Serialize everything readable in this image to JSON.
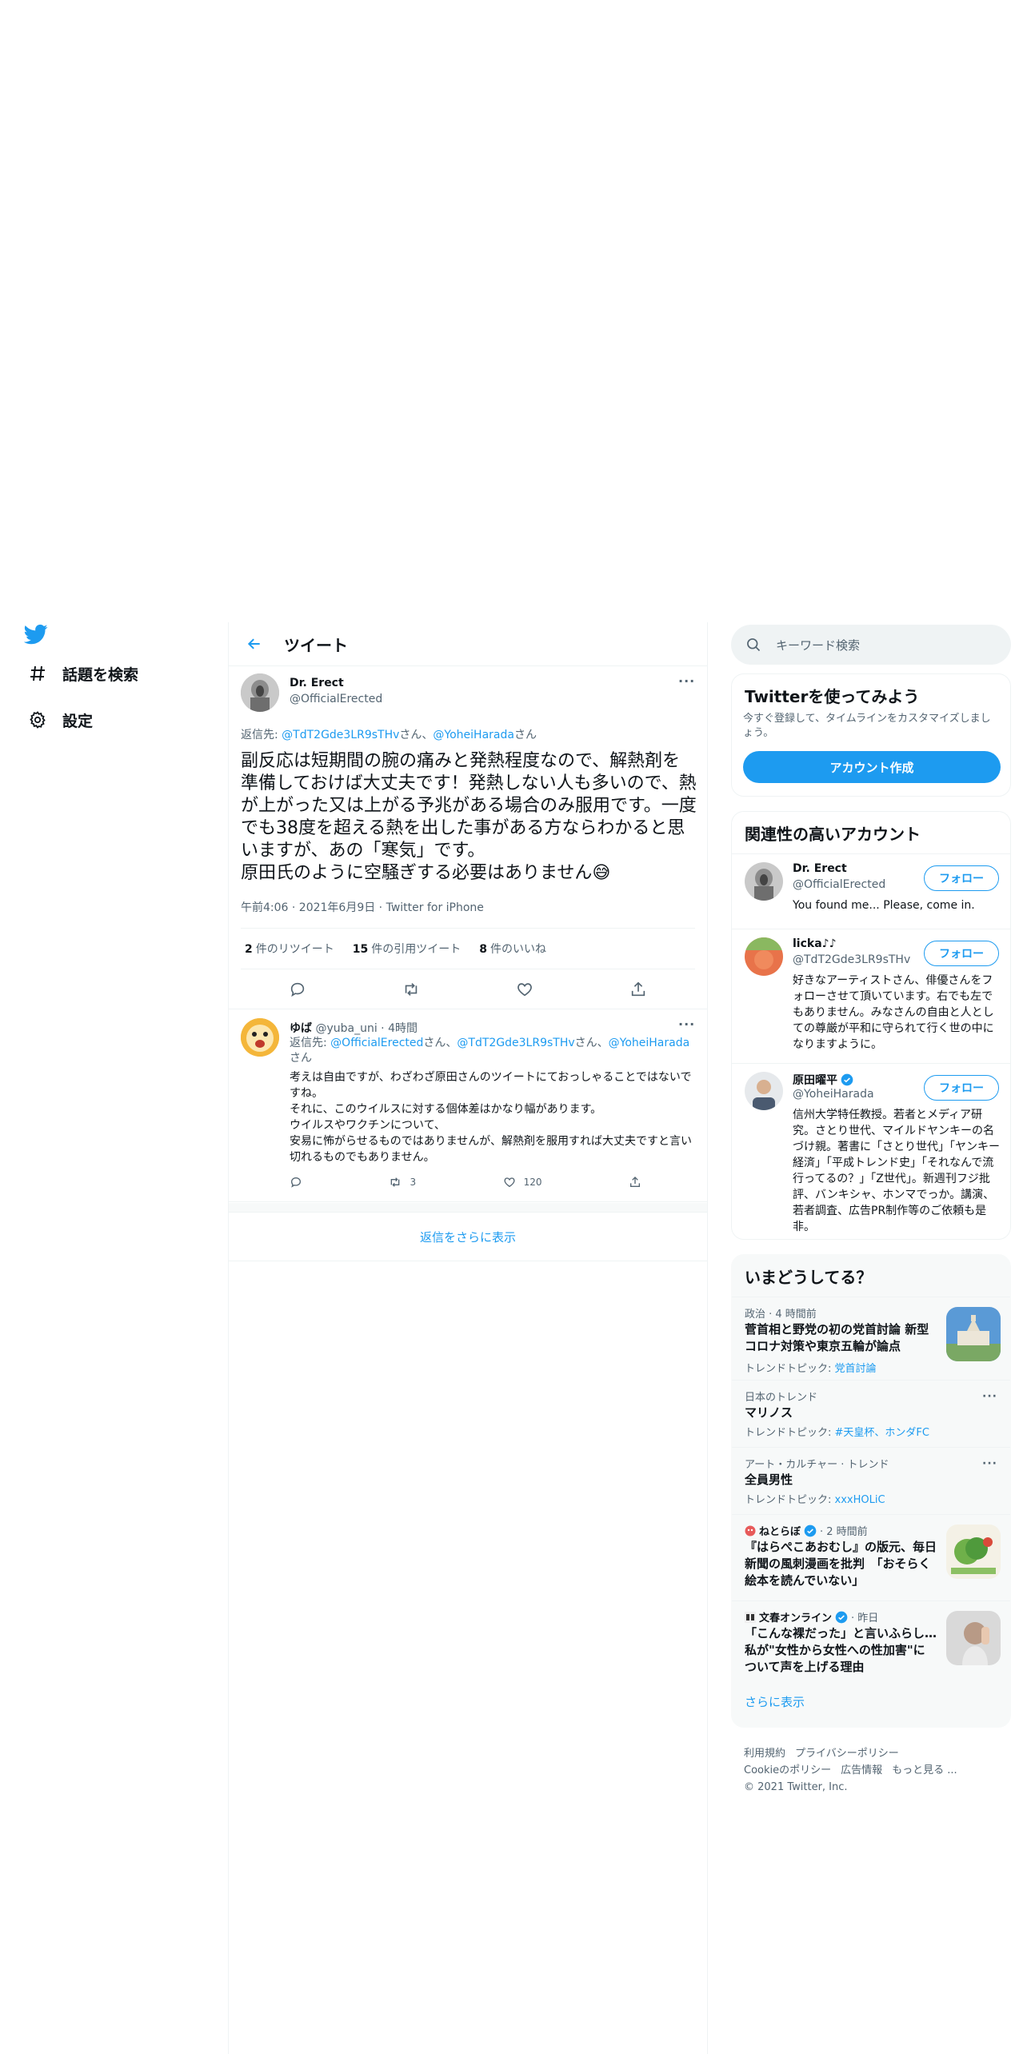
{
  "nav": {
    "explore_label": "話題を検索",
    "settings_label": "設定"
  },
  "header": {
    "title": "ツイート"
  },
  "tweet": {
    "name": "Dr. Erect",
    "handle": "@OfficialErected",
    "reply_prefix": "返信先: ",
    "reply_mention1": "@TdT2Gde3LR9sTHv",
    "reply_san1": "さん、",
    "reply_mention2": "@YoheiHarada",
    "reply_san2": "さん",
    "text": "副反応は短期間の腕の痛みと発熱程度なので、解熱剤を準備しておけば大丈夫です！発熱しない人も多いので、熱が上がった又は上がる予兆がある場合のみ服用です。一度でも38度を超える熱を出した事がある方ならわかると思いますが、あの「寒気」です。\n原田氏のように空騒ぎする必要はありません😅",
    "meta": "午前4:06 · 2021年6月9日 · Twitter for iPhone",
    "retweets_count": "2",
    "retweets_label": "件のリツイート",
    "quotes_count": "15",
    "quotes_label": "件の引用ツイート",
    "likes_count": "8",
    "likes_label": "件のいいね"
  },
  "reply": {
    "name": "ゆば",
    "handle": "@yuba_uni",
    "time": " · 4時間",
    "reply_prefix": "返信先: ",
    "mention1": "@OfficialErected",
    "san1": "さん、",
    "mention2": "@TdT2Gde3LR9sTHv",
    "san2": "さん、",
    "mention3": "@YoheiHarada",
    "san3": "さん",
    "text": "考えは自由ですが、わざわざ原田さんのツイートにておっしゃることではないですね。\nそれに、このウイルスに対する個体差はかなり幅があります。\nウイルスやワクチンについて、\n安易に怖がらせるものではありませんが、解熱剤を服用すれば大丈夫ですと言い切れるものでもありません。",
    "retweets": "3",
    "likes": "120"
  },
  "show_more_replies": "返信をさらに表示",
  "search": {
    "placeholder": "キーワード検索"
  },
  "signup": {
    "title": "Twitterを使ってみよう",
    "desc": "今すぐ登録して、タイムラインをカスタマイズしましょう。",
    "button": "アカウント作成"
  },
  "accounts": {
    "title": "関連性の高いアカウント",
    "follow_label": "フォロー",
    "items": [
      {
        "name": "Dr. Erect",
        "handle": "@OfficialErected",
        "bio": "You found me... Please, come in."
      },
      {
        "name": "licka♪♪",
        "handle": "@TdT2Gde3LR9sTHv",
        "bio": "好きなアーティストさん、俳優さんをフォローさせて頂いています。右でも左でもありません。みなさんの自由と人としての尊厳が平和に守られて行く世の中になりますように。"
      },
      {
        "name": "原田曜平",
        "handle": "@YoheiHarada",
        "bio": "信州大学特任教授。若者とメディア研究。さとり世代、マイルドヤンキーの名づけ親。著書に「さとり世代」「ヤンキー経済」「平成トレンド史」「それなんで流行ってるの？」「Z世代」。新週刊フジ批評、バンキシャ、ホンマでっか。講演、若者調査、広告PR制作等のご依頼も是非。"
      }
    ]
  },
  "trends": {
    "title": "いまどうしてる？",
    "items": [
      {
        "context": "政治 · 4 時間前",
        "title": "菅首相と野党の初の党首討論 新型コロナ対策や東京五輪が論点",
        "sub_prefix": "トレンドトピック: ",
        "sub_link": "党首討論"
      },
      {
        "context": "日本のトレンド",
        "title": "マリノス",
        "sub_prefix": "トレンドトピック: ",
        "sub_link": "#天皇杯、ホンダFC"
      },
      {
        "context": "アート・カルチャー · トレンド",
        "title": "全員男性",
        "sub_prefix": "トレンドトピック: ",
        "sub_link": "xxxHOLiC"
      },
      {
        "source": "ねとらぼ",
        "time": " · 2 時間前",
        "title": "『はらぺこあおむし』の版元、毎日新聞の風刺漫画を批判　「おそらく絵本を読んでいない」"
      },
      {
        "source": "文春オンライン",
        "time": " · 昨日",
        "title": "「こんな裸だった」と言いふらし…私が\"女性から女性への性加害\"について声を上げる理由"
      }
    ],
    "show_more": "さらに表示"
  },
  "footer": {
    "terms": "利用規約",
    "privacy": "プライバシーポリシー",
    "cookie": "Cookieのポリシー",
    "ads": "広告情報",
    "more": "もっと見る ...",
    "copyright": "© 2021 Twitter, Inc."
  },
  "colors": {
    "accent": "#1d9bf0",
    "secondary_text": "#536471",
    "border": "#eff3f4"
  }
}
